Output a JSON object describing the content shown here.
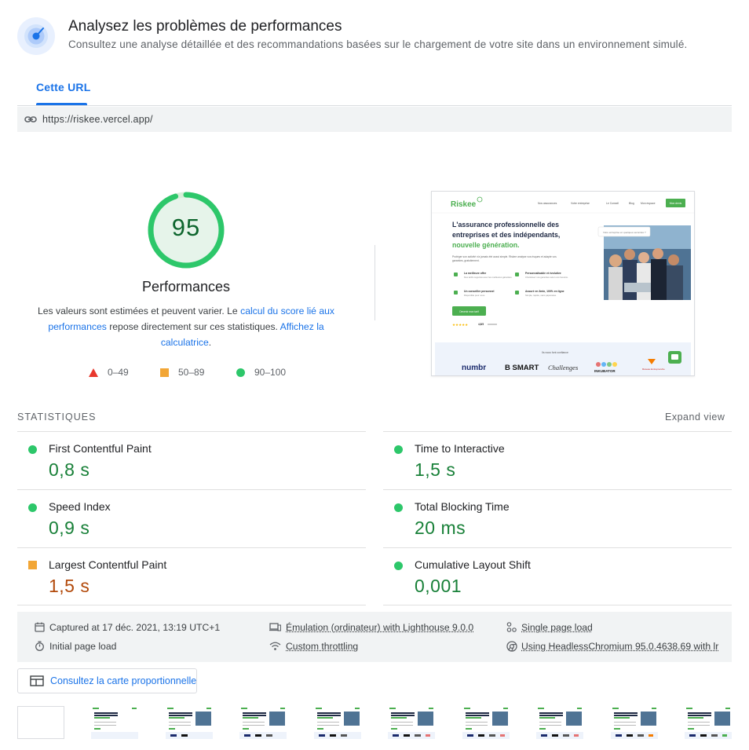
{
  "header": {
    "title": "Analysez les problèmes de performances",
    "subtitle": "Consultez une analyse détaillée et des recommandations basées sur le chargement de votre site dans un environnement simulé."
  },
  "tabs": [
    {
      "label": "Cette URL",
      "active": true
    }
  ],
  "url": "https://riskee.vercel.app/",
  "gauge": {
    "score": "95",
    "score_fraction": 0.95,
    "label": "Performances",
    "desc_before": "Les valeurs sont estimées et peuvent varier. Le ",
    "desc_link1": "calcul du score lié aux performances",
    "desc_middle": " repose directement sur ces statistiques. ",
    "desc_link2": "Affichez la calculatrice",
    "desc_end": "."
  },
  "legend": [
    {
      "range": "0–49",
      "color": "#e8382d",
      "shape": "triangle"
    },
    {
      "range": "50–89",
      "color": "#f2a636",
      "shape": "square"
    },
    {
      "range": "90–100",
      "color": "#2dc76a",
      "shape": "circle"
    }
  ],
  "screenshot": {
    "logo": "Riskee",
    "nav": [
      "Nos assurances",
      "Votre entreprise",
      "Le Conseil",
      "Blog",
      "Mon espace"
    ],
    "nav_button": "Mon devis",
    "headline_1": "L'assurance professionnelle des",
    "headline_2": "entreprises et des indépendants,",
    "headline_green": "nouvelle génération.",
    "intro_line_1": "Protéger son activité n'a jamais été aussi simple. Riskee analyse vos risques et adapte vos",
    "intro_line_2": "garanties, gratuitement.",
    "features": [
      {
        "title": "La meilleure offre",
        "sub": "Des tarifs négociés avec les meilleures garanties."
      },
      {
        "title": "Personnalisable et évolutive",
        "sub": "Choisissez vos garanties selon vos besoins."
      },
      {
        "title": "Un conseiller personnel",
        "sub": "Disponible pour vous."
      },
      {
        "title": "Assuré en 3min, 100% en ligne",
        "sub": "Simple, rapide, sans paperasse."
      }
    ],
    "cta": "Devenir mon tarif",
    "rating_text": "4,8/5",
    "search_hint": "Votre entreprise en quelques secondes ?",
    "trust_title": "Ils nous font confiance",
    "partners": [
      "numbr",
      "B SMART",
      "Challenges",
      "INKUBATOR",
      "Réseau Entreprendre"
    ]
  },
  "stats": {
    "title": "STATISTIQUES",
    "expand": "Expand view",
    "metrics": [
      {
        "name": "First Contentful Paint",
        "value": "0,8 s",
        "status": "good"
      },
      {
        "name": "Time to Interactive",
        "value": "1,5 s",
        "status": "good"
      },
      {
        "name": "Speed Index",
        "value": "0,9 s",
        "status": "good"
      },
      {
        "name": "Total Blocking Time",
        "value": "20 ms",
        "status": "good"
      },
      {
        "name": "Largest Contentful Paint",
        "value": "1,5 s",
        "status": "average"
      },
      {
        "name": "Cumulative Layout Shift",
        "value": "0,001",
        "status": "good"
      }
    ]
  },
  "runtime": {
    "captured": "Captured at 17 déc. 2021, 13:19 UTC+1",
    "emulation": "Émulation (ordinateur) with Lighthouse 9.0.0",
    "single": "Single page load",
    "initial": "Initial page load",
    "throttling": "Custom throttling",
    "browser": "Using HeadlessChromium 95.0.4638.69 with lr"
  },
  "treemap_label": "Consultez la carte proportionnelle",
  "colors": {
    "accent": "#1a73e8",
    "pass": "#188038",
    "pass_fill": "#2dc76a",
    "average": "#b2490a",
    "average_fill": "#f2a636",
    "fail": "#e8382d"
  }
}
